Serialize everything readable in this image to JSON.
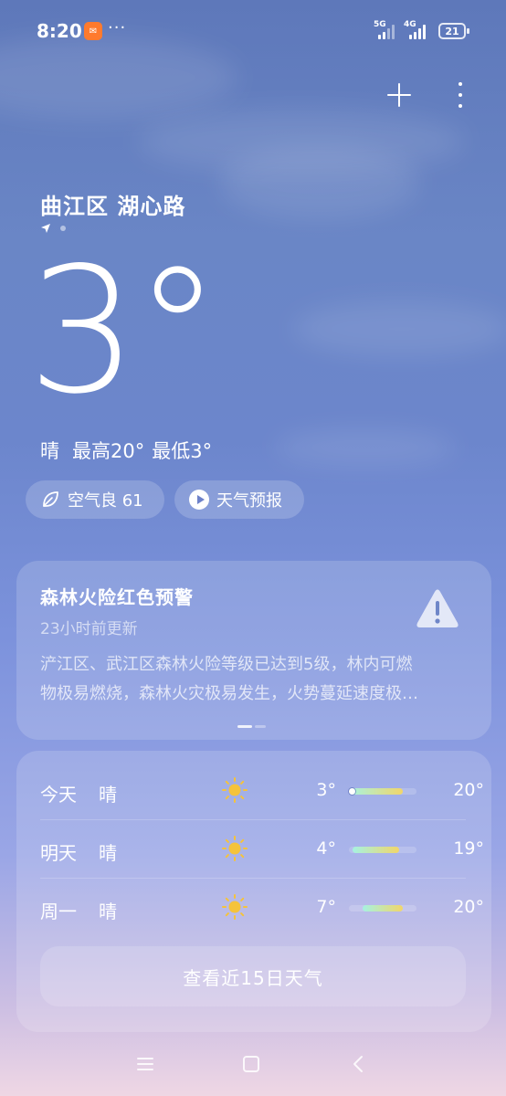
{
  "status_bar": {
    "time": "8:20",
    "more_indicator": "···",
    "network_1": "5G",
    "network_2": "4G",
    "battery_level": "21",
    "icons": [
      "notification-app-icon",
      "signal-icon",
      "battery-icon"
    ]
  },
  "top_actions": {
    "add_icon": "plus-icon",
    "more_icon": "more-vertical-icon"
  },
  "location": {
    "name": "曲江区 湖心路",
    "indicator_icon": "location-arrow-icon"
  },
  "current": {
    "temperature": "3°",
    "condition": "晴",
    "high": "最高20°",
    "low": "最低3°"
  },
  "chips": {
    "air_quality": "空气良 61",
    "air_icon": "leaf-icon",
    "forecast": "天气预报",
    "forecast_icon": "play-icon"
  },
  "alert": {
    "title": "森林火险红色预警",
    "updated": "23小时前更新",
    "line1": "浐江区、武江区森林火险等级已达到5级，林内可燃",
    "line2": "物极易燃烧，森林火灾极易发生，火势蔓延速度极…",
    "icon": "warning-icon"
  },
  "daily": [
    {
      "day": "今天",
      "condition": "晴",
      "icon": "sun-icon",
      "low": "3°",
      "high": "20°",
      "range_fraction": [
        0.0,
        0.8
      ],
      "is_today": true
    },
    {
      "day": "明天",
      "condition": "晴",
      "icon": "sun-icon",
      "low": "4°",
      "high": "19°",
      "range_fraction": [
        0.05,
        0.75
      ],
      "is_today": false
    },
    {
      "day": "周一",
      "condition": "晴",
      "icon": "sun-icon",
      "low": "7°",
      "high": "20°",
      "range_fraction": [
        0.2,
        0.8
      ],
      "is_today": false
    }
  ],
  "more_forecast_button": "查看近15日天气",
  "nav_bar": {
    "menu_icon": "menu-icon",
    "home_icon": "home-icon",
    "back_icon": "back-icon"
  },
  "colors": {
    "bar_start": "#a6f2e1",
    "bar_end": "#f1d66a",
    "sun": "#f5c33b"
  }
}
